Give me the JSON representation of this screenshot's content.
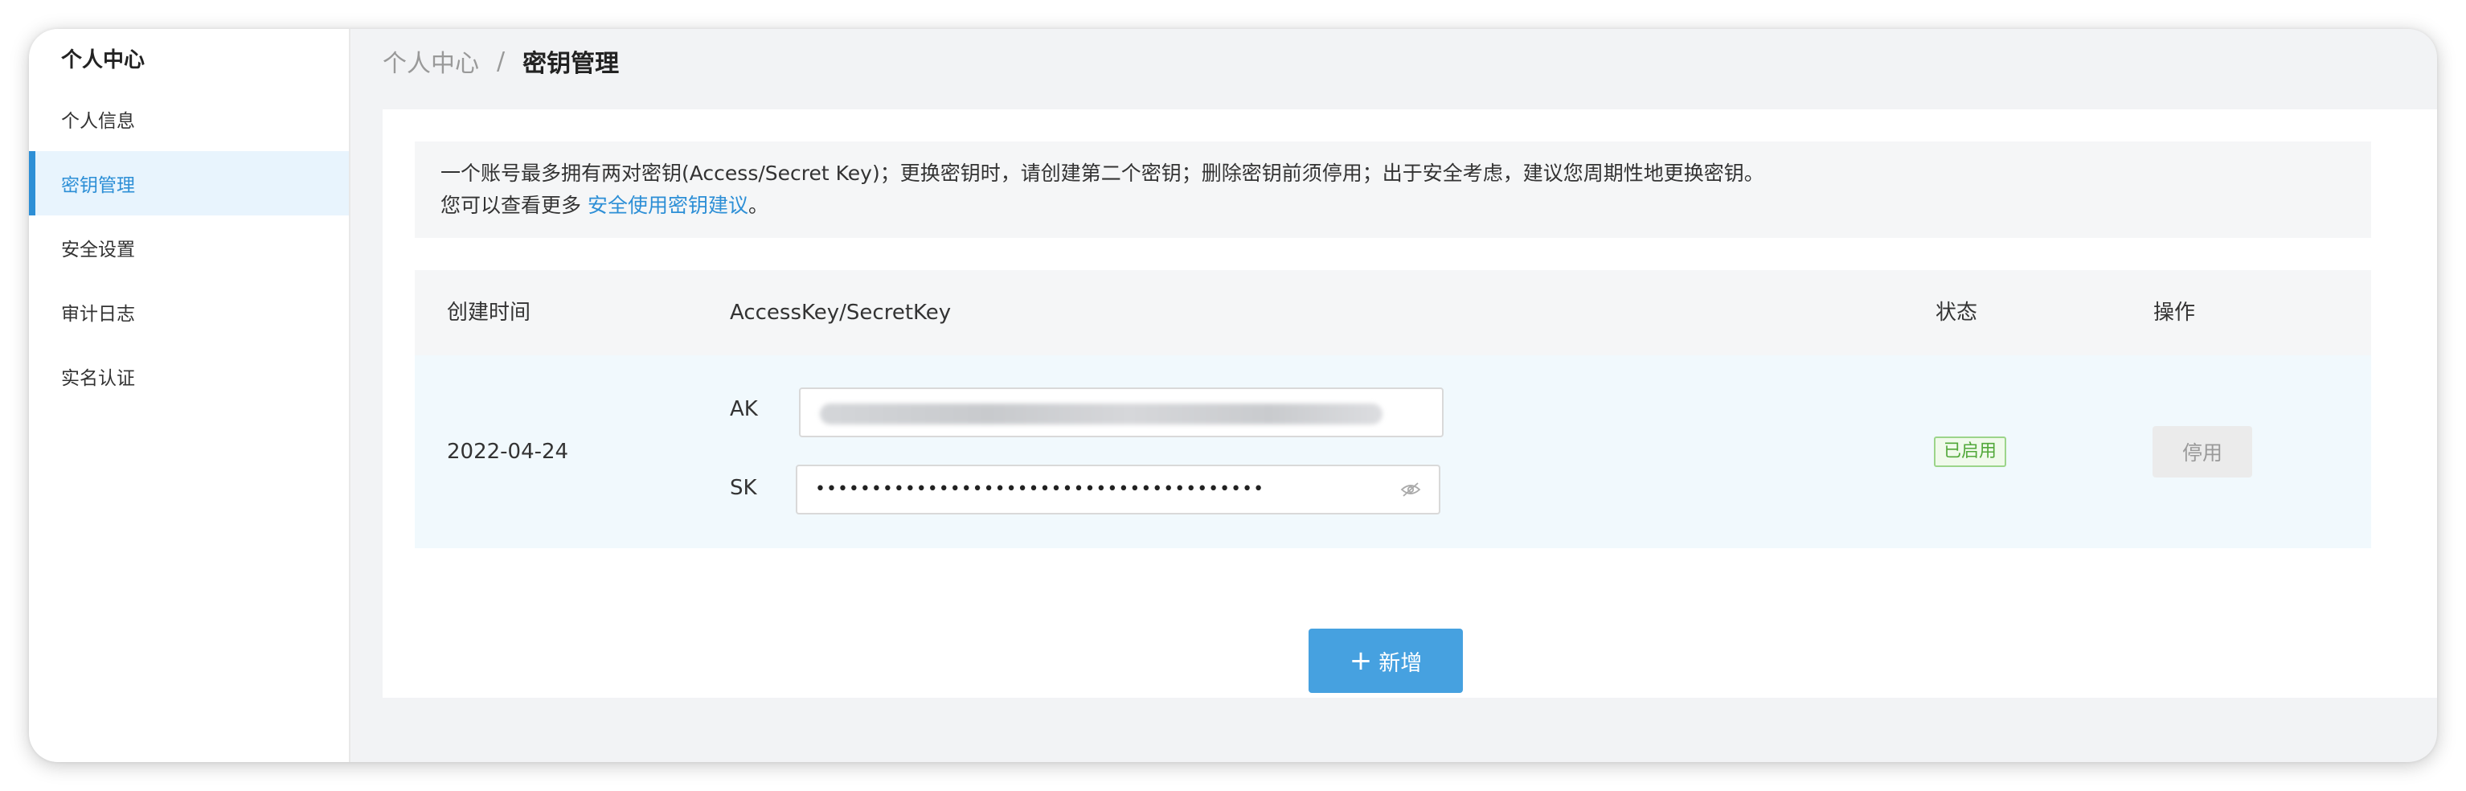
{
  "sidebar": {
    "title": "个人中心",
    "items": [
      {
        "label": "个人信息"
      },
      {
        "label": "密钥管理"
      },
      {
        "label": "安全设置"
      },
      {
        "label": "审计日志"
      },
      {
        "label": "实名认证"
      }
    ],
    "active_index": 1
  },
  "breadcrumb": {
    "parent": "个人中心",
    "separator": "/",
    "current": "密钥管理"
  },
  "notice": {
    "line1": "一个账号最多拥有两对密钥(Access/Secret Key)；更换密钥时，请创建第二个密钥；删除密钥前须停用；出于安全考虑，建议您周期性地更换密钥。",
    "line2_prefix": "您可以查看更多 ",
    "line2_link": "安全使用密钥建议",
    "line2_suffix": "。"
  },
  "table": {
    "headers": {
      "created": "创建时间",
      "keys": "AccessKey/SecretKey",
      "status": "状态",
      "actions": "操作"
    },
    "rows": [
      {
        "created": "2022-04-24",
        "ak_label": "AK",
        "sk_label": "SK",
        "sk_value": "••••••••••••••••••••••••••••••••••••••••",
        "status": "已启用",
        "action": "停用"
      }
    ]
  },
  "add_button": {
    "label": "新增",
    "icon": "plus-icon"
  },
  "icons": {
    "visibility_toggle": "eye-off-icon"
  },
  "colors": {
    "accent": "#2d8fd6",
    "primary_button": "#46a1e0",
    "status_green": "#52a83a",
    "row_highlight": "#f1f9fd"
  }
}
